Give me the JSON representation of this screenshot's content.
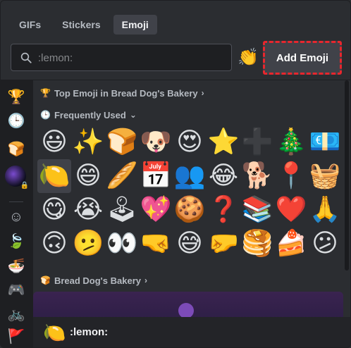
{
  "tabs": [
    {
      "label": "GIFs"
    },
    {
      "label": "Stickers"
    },
    {
      "label": "Emoji"
    }
  ],
  "search": {
    "placeholder": ":lemon:"
  },
  "toolbar": {
    "add_emoji_label": "Add Emoji",
    "diversity_emoji": "👏"
  },
  "sidebar": {
    "top_icon": "🏆",
    "recent_icon": "🕒",
    "bread_icon": "🍞",
    "categories": [
      "☺",
      "🍃",
      "🍜",
      "🎮",
      "🚲",
      "🚩"
    ]
  },
  "sections": {
    "top": {
      "label": "Top Emoji in Bread Dog's Bakery",
      "chevron": "›",
      "icon": "🏆"
    },
    "frequent": {
      "label": "Frequently Used",
      "chevron": "⌄",
      "icon": "🕒"
    },
    "bakery": {
      "label": "Bread Dog's Bakery",
      "chevron": "›",
      "icon": "🍞"
    }
  },
  "emojis": [
    "😃",
    "✨",
    "🍞",
    "🐶",
    "😍",
    "⭐",
    "➕",
    "🎄",
    "💶",
    "🍋",
    "😄",
    "🥖",
    "📅",
    "👥",
    "😂",
    "🐕",
    "📍",
    "🧺",
    "😋",
    "😭",
    "🕹",
    "💖",
    "🍪",
    "❓",
    "📚",
    "❤️",
    "🙏",
    "🙃",
    "🫤",
    "👀",
    "🤜",
    "😅",
    "🤛",
    "🥞",
    "🍰",
    "😕"
  ],
  "preview": {
    "emoji": "🍋",
    "name": ":lemon:"
  }
}
